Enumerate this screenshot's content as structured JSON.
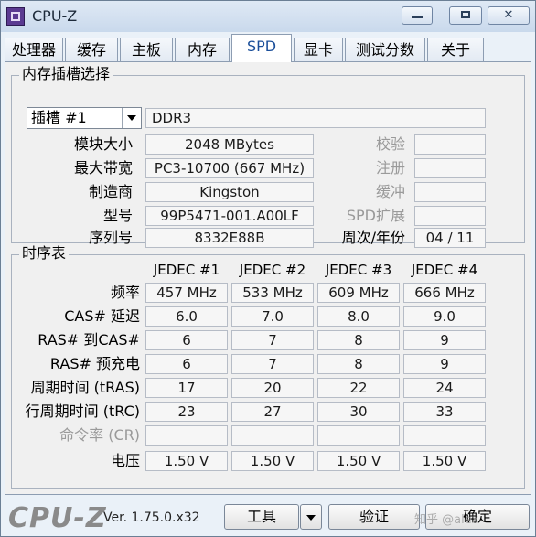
{
  "window": {
    "title": "CPU-Z"
  },
  "tabs": [
    {
      "label": "处理器"
    },
    {
      "label": "缓存"
    },
    {
      "label": "主板"
    },
    {
      "label": "内存"
    },
    {
      "label": "SPD",
      "active": true
    },
    {
      "label": "显卡"
    },
    {
      "label": "测试分数"
    },
    {
      "label": "关于"
    }
  ],
  "slot_group": {
    "title": "内存插槽选择",
    "slot_select": "插槽 #1",
    "memory_type": "DDR3",
    "rows": [
      {
        "label": "模块大小",
        "value": "2048 MBytes",
        "right_label": "校验",
        "right_value": ""
      },
      {
        "label": "最大带宽",
        "value": "PC3-10700 (667 MHz)",
        "right_label": "注册",
        "right_value": ""
      },
      {
        "label": "制造商",
        "value": "Kingston",
        "right_label": "缓冲",
        "right_value": ""
      },
      {
        "label": "型号",
        "value": "99P5471-001.A00LF",
        "right_label": "SPD扩展",
        "right_value": ""
      },
      {
        "label": "序列号",
        "value": "8332E88B",
        "right_label": "周次/年份",
        "right_value": "04 / 11"
      }
    ]
  },
  "timing_group": {
    "title": "时序表",
    "columns": [
      "JEDEC #1",
      "JEDEC #2",
      "JEDEC #3",
      "JEDEC #4"
    ],
    "rows": [
      {
        "label": "频率",
        "values": [
          "457 MHz",
          "533 MHz",
          "609 MHz",
          "666 MHz"
        ]
      },
      {
        "label": "CAS# 延迟",
        "values": [
          "6.0",
          "7.0",
          "8.0",
          "9.0"
        ]
      },
      {
        "label": "RAS# 到CAS#",
        "values": [
          "6",
          "7",
          "8",
          "9"
        ]
      },
      {
        "label": "RAS# 预充电",
        "values": [
          "6",
          "7",
          "8",
          "9"
        ]
      },
      {
        "label": "周期时间 (tRAS)",
        "values": [
          "17",
          "20",
          "22",
          "24"
        ]
      },
      {
        "label": "行周期时间 (tRC)",
        "values": [
          "23",
          "27",
          "30",
          "33"
        ]
      },
      {
        "label": "命令率 (CR)",
        "values": [
          "",
          "",
          "",
          ""
        ],
        "disabled": true
      },
      {
        "label": "电压",
        "values": [
          "1.50 V",
          "1.50 V",
          "1.50 V",
          "1.50 V"
        ]
      }
    ]
  },
  "bottom": {
    "logo": "CPU-Z",
    "version": "Ver. 1.75.0.x32",
    "tools_label": "工具",
    "validate_label": "验证",
    "ok_label": "确定",
    "watermark": "知乎 @alex"
  }
}
